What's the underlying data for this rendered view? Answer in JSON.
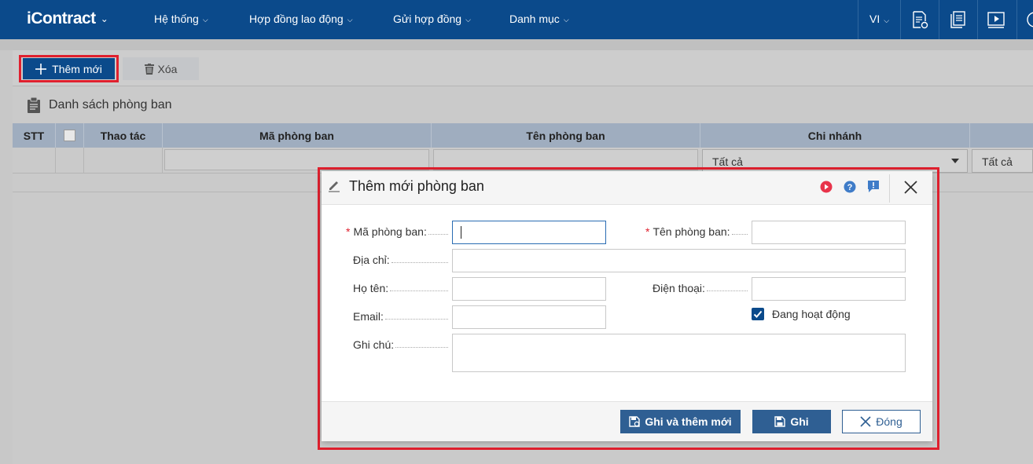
{
  "app": {
    "logo": "iContract"
  },
  "nav": {
    "items": [
      {
        "label": "Hệ thống"
      },
      {
        "label": "Hợp đồng lao động"
      },
      {
        "label": "Gửi hợp đồng"
      },
      {
        "label": "Danh mục"
      }
    ],
    "language": "VI"
  },
  "toolbar": {
    "add_label": "Thêm mới",
    "delete_label": "Xóa"
  },
  "list": {
    "title": "Danh sách phòng ban",
    "columns": [
      "STT",
      "Thao tác",
      "Mã phòng ban",
      "Tên phòng ban",
      "Chi nhánh"
    ],
    "branch_filter": "Tất cả",
    "extra_filter": "Tất cả"
  },
  "dialog": {
    "title": "Thêm mới phòng ban",
    "fields": {
      "code": {
        "label": "Mã phòng ban:",
        "value": ""
      },
      "name": {
        "label": "Tên phòng ban:",
        "value": ""
      },
      "address": {
        "label": "Địa chỉ:",
        "value": ""
      },
      "fullname": {
        "label": "Họ tên:",
        "value": ""
      },
      "phone": {
        "label": "Điện thoại:",
        "value": ""
      },
      "email": {
        "label": "Email:",
        "value": ""
      },
      "note": {
        "label": "Ghi chú:",
        "value": ""
      }
    },
    "active": {
      "label": "Đang hoạt động",
      "checked": true
    },
    "buttons": {
      "save_new": "Ghi và thêm mới",
      "save": "Ghi",
      "close": "Đóng"
    }
  },
  "colors": {
    "brand": "#0b4a8b",
    "highlight": "#e0202e",
    "button": "#2f5f93"
  }
}
